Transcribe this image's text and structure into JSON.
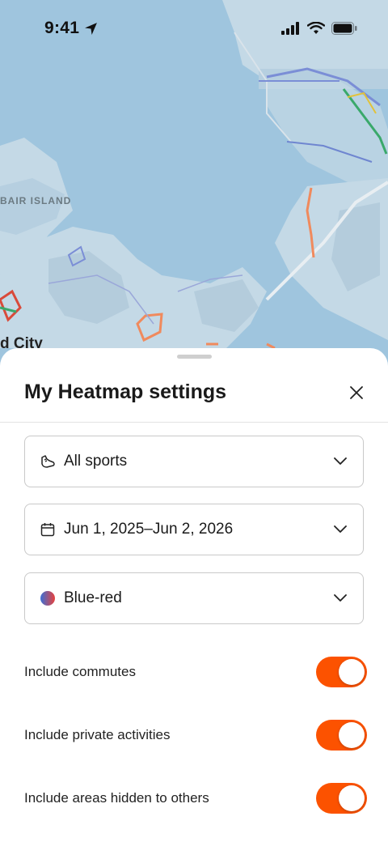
{
  "status_bar": {
    "time": "9:41",
    "icons": [
      "location-arrow-icon",
      "cellular-signal-icon",
      "wifi-icon",
      "battery-icon"
    ]
  },
  "map": {
    "labels": [
      "BAIR ISLAND",
      "d City"
    ],
    "colors": {
      "water": "#9fc5de",
      "land": "#c4d9e6",
      "route": "#f08a5d"
    }
  },
  "sheet": {
    "title": "My Heatmap settings",
    "close_icon": "close-icon",
    "dropdowns": [
      {
        "icon": "shoe-icon",
        "label": "All sports"
      },
      {
        "icon": "calendar-icon",
        "label": "Jun 1, 2025–Jun 2, 2026"
      },
      {
        "icon": "blue-red-gradient-swatch",
        "label": "Blue-red"
      }
    ],
    "toggles": [
      {
        "label": "Include commutes",
        "on": true
      },
      {
        "label": "Include private activities",
        "on": true
      },
      {
        "label": "Include areas hidden to others",
        "on": true
      }
    ],
    "accent": "#fc5200"
  }
}
